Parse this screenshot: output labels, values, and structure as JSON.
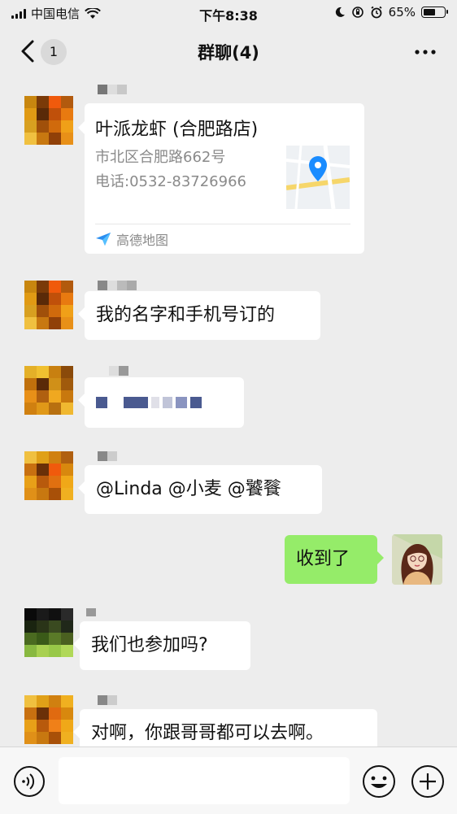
{
  "status_bar": {
    "carrier": "中国电信",
    "time": "下午8:38",
    "battery": "65%",
    "battery_level": 0.65
  },
  "nav": {
    "back_badge": "1",
    "title": "群聊(4)"
  },
  "location_card": {
    "title": "叶派龙虾 (合肥路店)",
    "address": "市北区合肥路662号",
    "phone": "电话:0532-83726966",
    "source": "高德地图"
  },
  "messages": [
    {
      "side": "left",
      "text": "我的名字和手机号订的"
    },
    {
      "side": "left",
      "text": ""
    },
    {
      "side": "left",
      "text": "@Linda @小麦 @饕餮"
    },
    {
      "side": "right",
      "text": "收到了"
    },
    {
      "side": "left",
      "text": "我们也参加吗?"
    },
    {
      "side": "left",
      "text": "对啊，你跟哥哥都可以去啊。"
    }
  ],
  "colors": {
    "bg": "#ededed",
    "bubble_self": "#95ec69",
    "bubble_other": "#ffffff"
  }
}
